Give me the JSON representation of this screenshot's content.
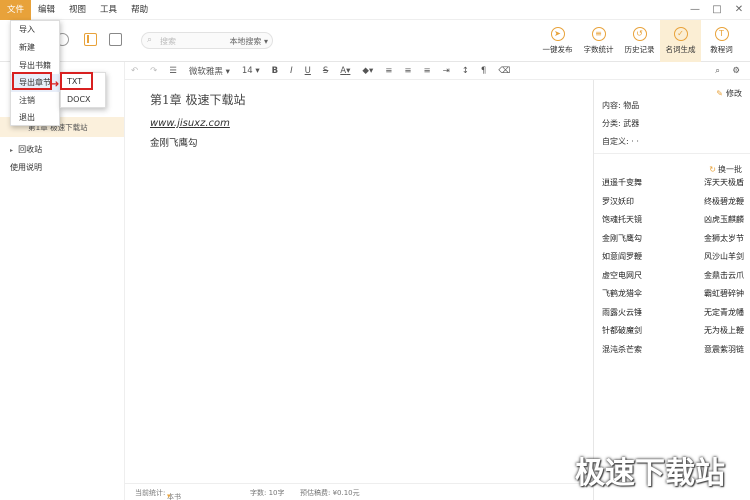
{
  "menubar": {
    "items": [
      "文件",
      "编辑",
      "视图",
      "工具",
      "帮助"
    ]
  },
  "file_menu": {
    "items": [
      "导入",
      "新建",
      "导出书籍",
      "导出章节",
      "注销",
      "退出"
    ]
  },
  "export_submenu": {
    "items": [
      "TXT",
      "DOCX"
    ]
  },
  "search": {
    "placeholder": "搜索",
    "scope": "本地搜索"
  },
  "toolbar_right": {
    "items": [
      {
        "label": "一键发布",
        "icon": "publish-icon"
      },
      {
        "label": "字数统计",
        "icon": "wordcount-icon"
      },
      {
        "label": "历史记录",
        "icon": "history-icon"
      },
      {
        "label": "名词生成",
        "icon": "name-generator-icon"
      },
      {
        "label": "教程词",
        "icon": "tutorial-icon"
      }
    ]
  },
  "left_panel": {
    "chapter": "第1章 极速下载站",
    "recycle": "回收站",
    "help": "使用说明"
  },
  "editor_toolbar": {
    "font": "微软雅黑",
    "size": "14",
    "bold": "B",
    "italic": "I",
    "underline": "U",
    "strike": "S",
    "font_color": "A"
  },
  "editor": {
    "title": "第1章 极速下载站",
    "link": "www.jisuxz.com",
    "body": "金刚飞鹰勾"
  },
  "status": {
    "scope_label": "当前统计:",
    "scope_value": "本书",
    "words": "字数: 10字",
    "fee": "预估稿费: ¥0.10元"
  },
  "right_panel": {
    "edit": "修改",
    "content": "内容: 物品",
    "category": "分类: 武器",
    "custom": "自定义: · ·",
    "refresh": "换一批",
    "names": [
      [
        "逍遥千变舞",
        "浑天天极盾"
      ],
      [
        "罗汉妖印",
        "终极碧龙鞭"
      ],
      [
        "饱魂托天镜",
        "凶虎玉麒麟"
      ],
      [
        "金刚飞鹰勾",
        "金狮太岁节"
      ],
      [
        "如意阎罗鞭",
        "风沙山羊剑"
      ],
      [
        "虚空电网尺",
        "金鼎击云爪"
      ],
      [
        "飞鹤龙猎伞",
        "霸虹碧碎钟"
      ],
      [
        "雨露火云锤",
        "无定青龙幡"
      ],
      [
        "针都破魔剑",
        "无为极上鞭"
      ],
      [
        "混沌杀芒索",
        "意震紫羽链"
      ]
    ]
  },
  "watermark": "极速下载站",
  "colors": {
    "accent": "#e8a23a",
    "annotation": "#d82020"
  }
}
